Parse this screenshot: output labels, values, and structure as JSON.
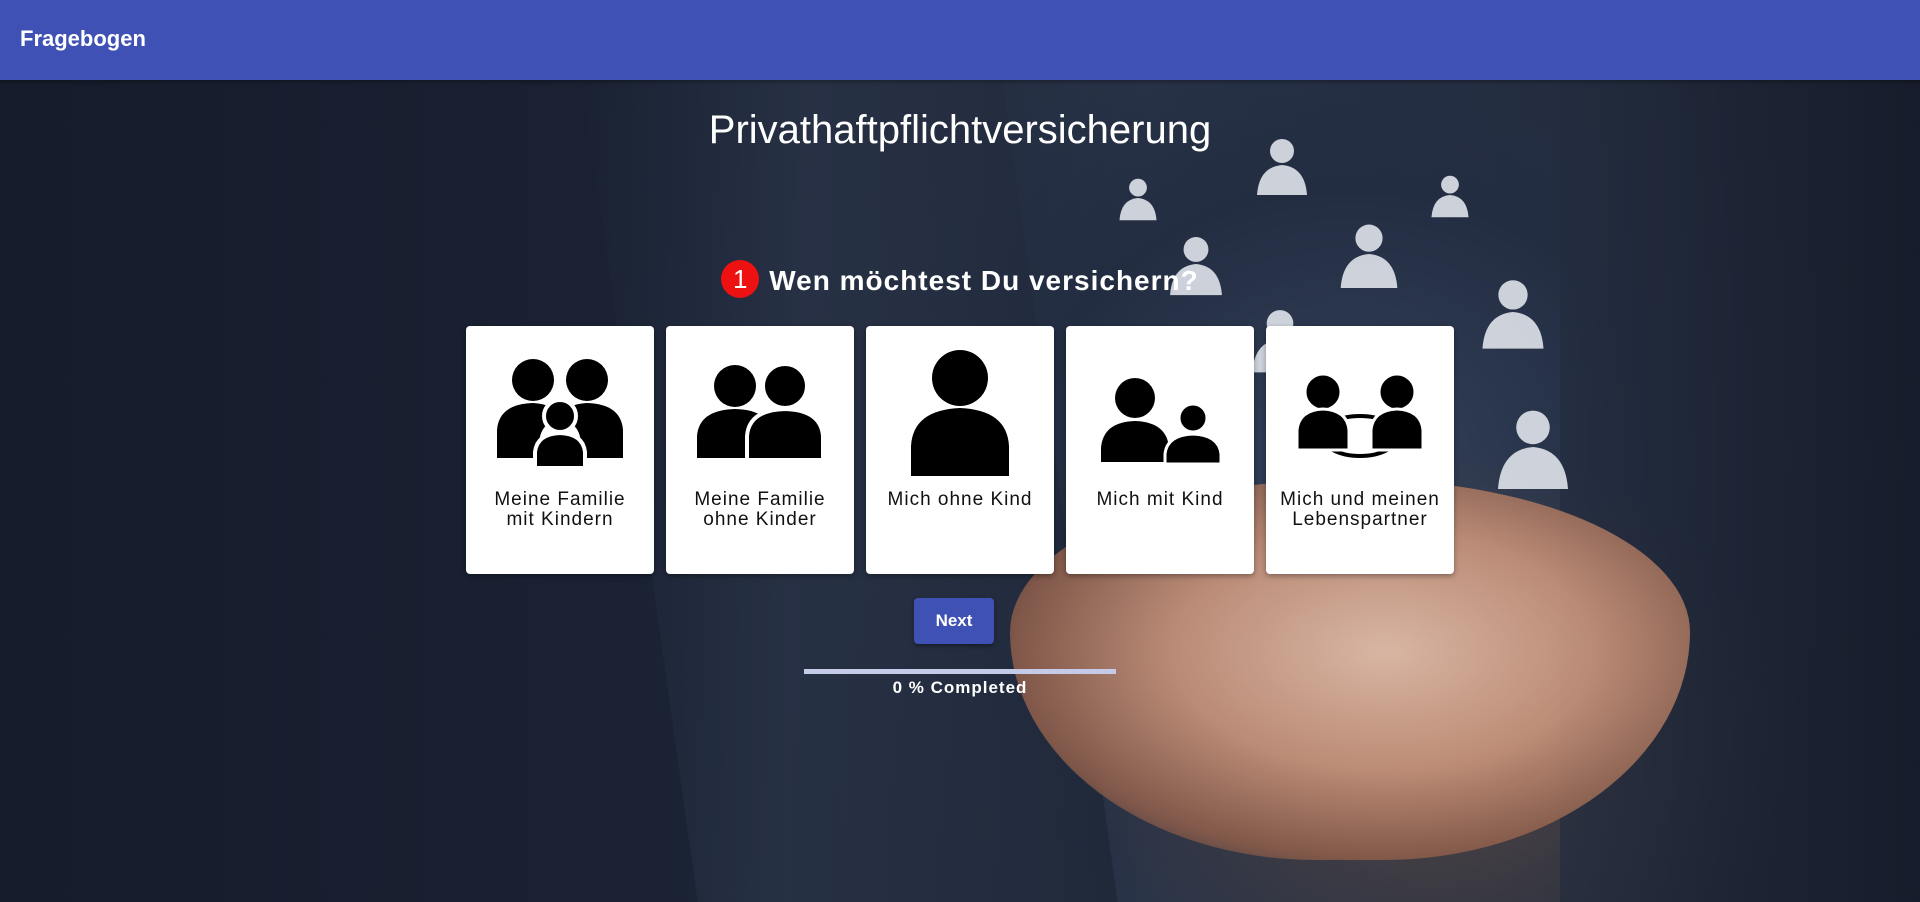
{
  "header": {
    "title": "Fragebogen",
    "color": "#3f51b5"
  },
  "main": {
    "title": "Privathaftpflichtversicherung",
    "question": {
      "number": "1",
      "text": "Wen möchtest Du versichern?",
      "number_color": "#ee1111"
    },
    "options": [
      {
        "label": "Meine Familie mit Kindern",
        "icon": "family-with-child-icon"
      },
      {
        "label": "Meine Familie ohne Kinder",
        "icon": "couple-icon"
      },
      {
        "label": "Mich ohne Kind",
        "icon": "single-person-icon"
      },
      {
        "label": "Mich mit Kind",
        "icon": "parent-with-child-icon"
      },
      {
        "label": "Mich und meinen Lebenspartner",
        "icon": "partners-connected-icon"
      }
    ],
    "next_label": "Next",
    "progress": {
      "percent": 0,
      "text": "0 % Completed"
    }
  }
}
